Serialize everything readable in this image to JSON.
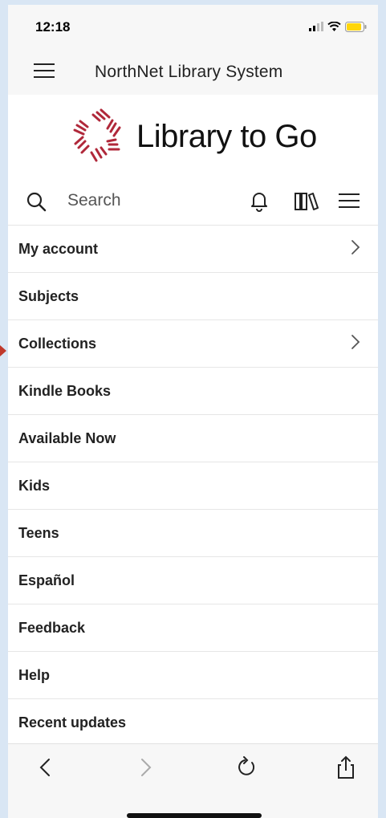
{
  "status_bar": {
    "time": "12:18",
    "icons": [
      "signal-icon",
      "wifi-icon",
      "battery-icon"
    ]
  },
  "header": {
    "title": "NorthNet Library System",
    "menu_icon": "hamburger-icon"
  },
  "logo": {
    "text": "Library to Go",
    "brand_color": "#b0283a"
  },
  "toolbar": {
    "search_placeholder": "Search",
    "icons": [
      "search-icon",
      "bell-icon",
      "books-icon",
      "hamburger-icon"
    ]
  },
  "menu": {
    "items": [
      {
        "label": "My account",
        "has_chevron": true
      },
      {
        "label": "Subjects",
        "has_chevron": false
      },
      {
        "label": "Collections",
        "has_chevron": true
      },
      {
        "label": "Kindle Books",
        "has_chevron": false
      },
      {
        "label": "Available Now",
        "has_chevron": false
      },
      {
        "label": "Kids",
        "has_chevron": false
      },
      {
        "label": "Teens",
        "has_chevron": false
      },
      {
        "label": "Español",
        "has_chevron": false
      },
      {
        "label": "Feedback",
        "has_chevron": false
      },
      {
        "label": "Help",
        "has_chevron": false
      },
      {
        "label": "Recent updates",
        "has_chevron": false
      }
    ]
  },
  "browser_nav": {
    "icons": [
      "back-icon",
      "forward-icon",
      "reload-icon",
      "share-icon"
    ]
  }
}
